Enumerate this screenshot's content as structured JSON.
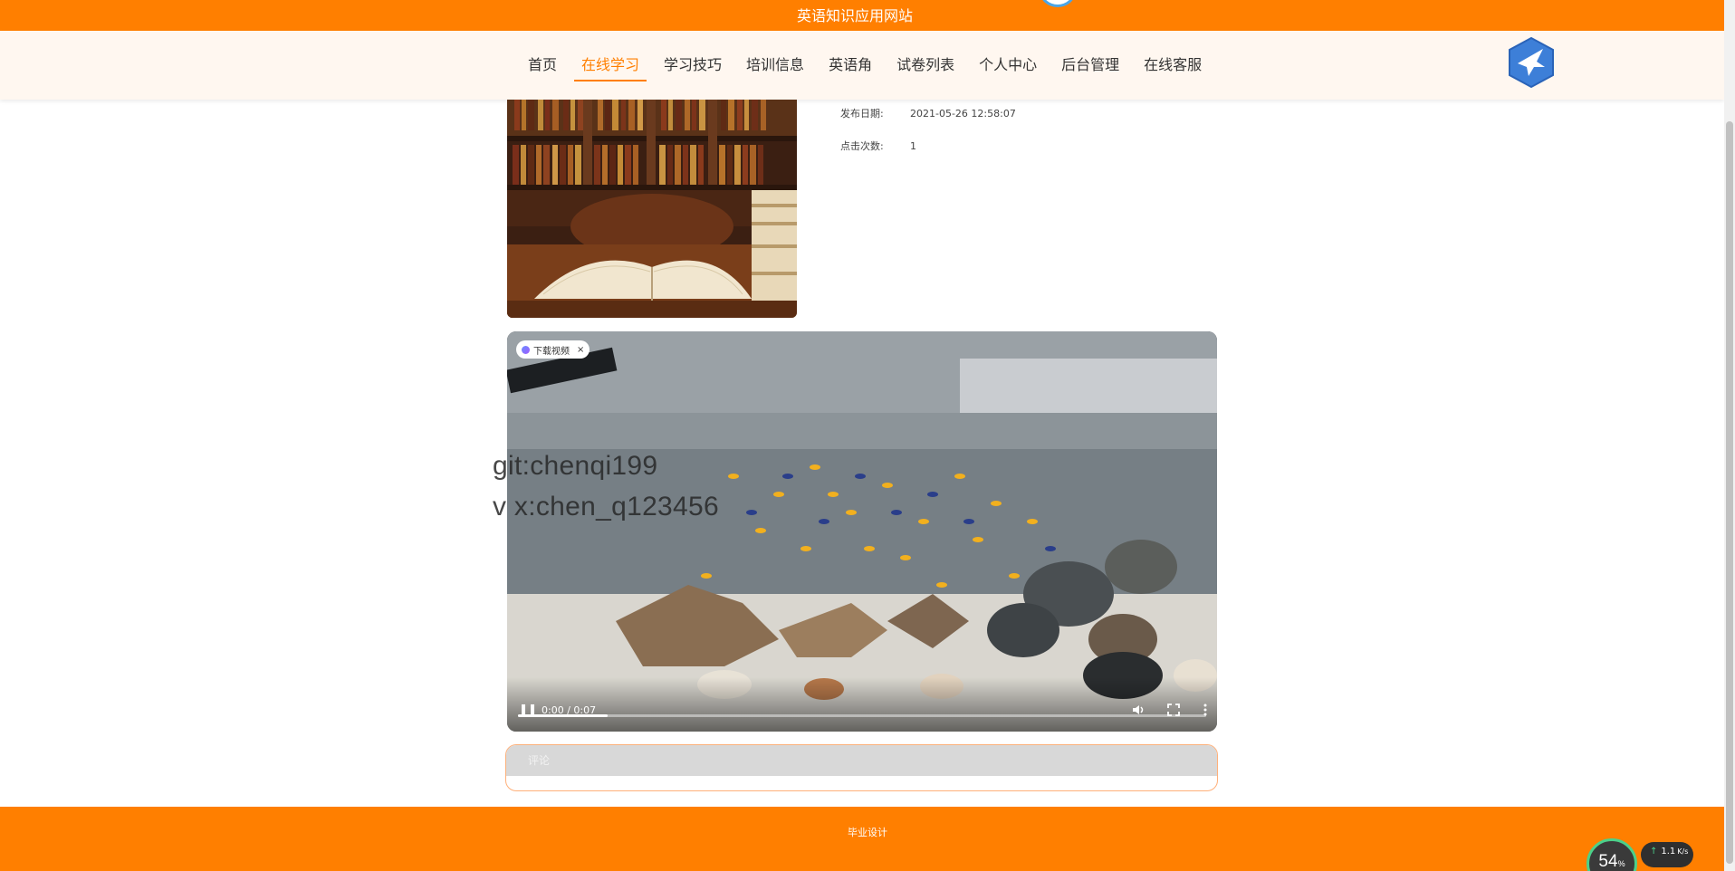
{
  "header": {
    "site_title": "英语知识应用网站"
  },
  "nav": {
    "items": [
      {
        "label": "首页",
        "active": false
      },
      {
        "label": "在线学习",
        "active": true
      },
      {
        "label": "学习技巧",
        "active": false
      },
      {
        "label": "培训信息",
        "active": false
      },
      {
        "label": "英语角",
        "active": false
      },
      {
        "label": "试卷列表",
        "active": false
      },
      {
        "label": "个人中心",
        "active": false
      },
      {
        "label": "后台管理",
        "active": false
      },
      {
        "label": "在线客服",
        "active": false
      }
    ],
    "logo_icon": "bird-logo-icon",
    "accent_color": "#ff7f00"
  },
  "detail": {
    "publish_label": "发布日期:",
    "publish_value": "2021-05-26 12:58:07",
    "clicks_label": "点击次数:",
    "clicks_value": "1"
  },
  "video": {
    "download_chip": "下载视频",
    "download_close": "×",
    "time": "0:00 / 0:07",
    "progress_fraction": 0.13
  },
  "watermark": {
    "line1": "git:chenqi199",
    "line2": "v x:chen_q123456"
  },
  "comment": {
    "placeholder": "评论"
  },
  "footer": {
    "text": "毕业设计"
  },
  "speed_widget": {
    "gauge_value": "54",
    "gauge_unit": "%",
    "upload_rate": "1.1",
    "upload_unit": "K/s"
  }
}
